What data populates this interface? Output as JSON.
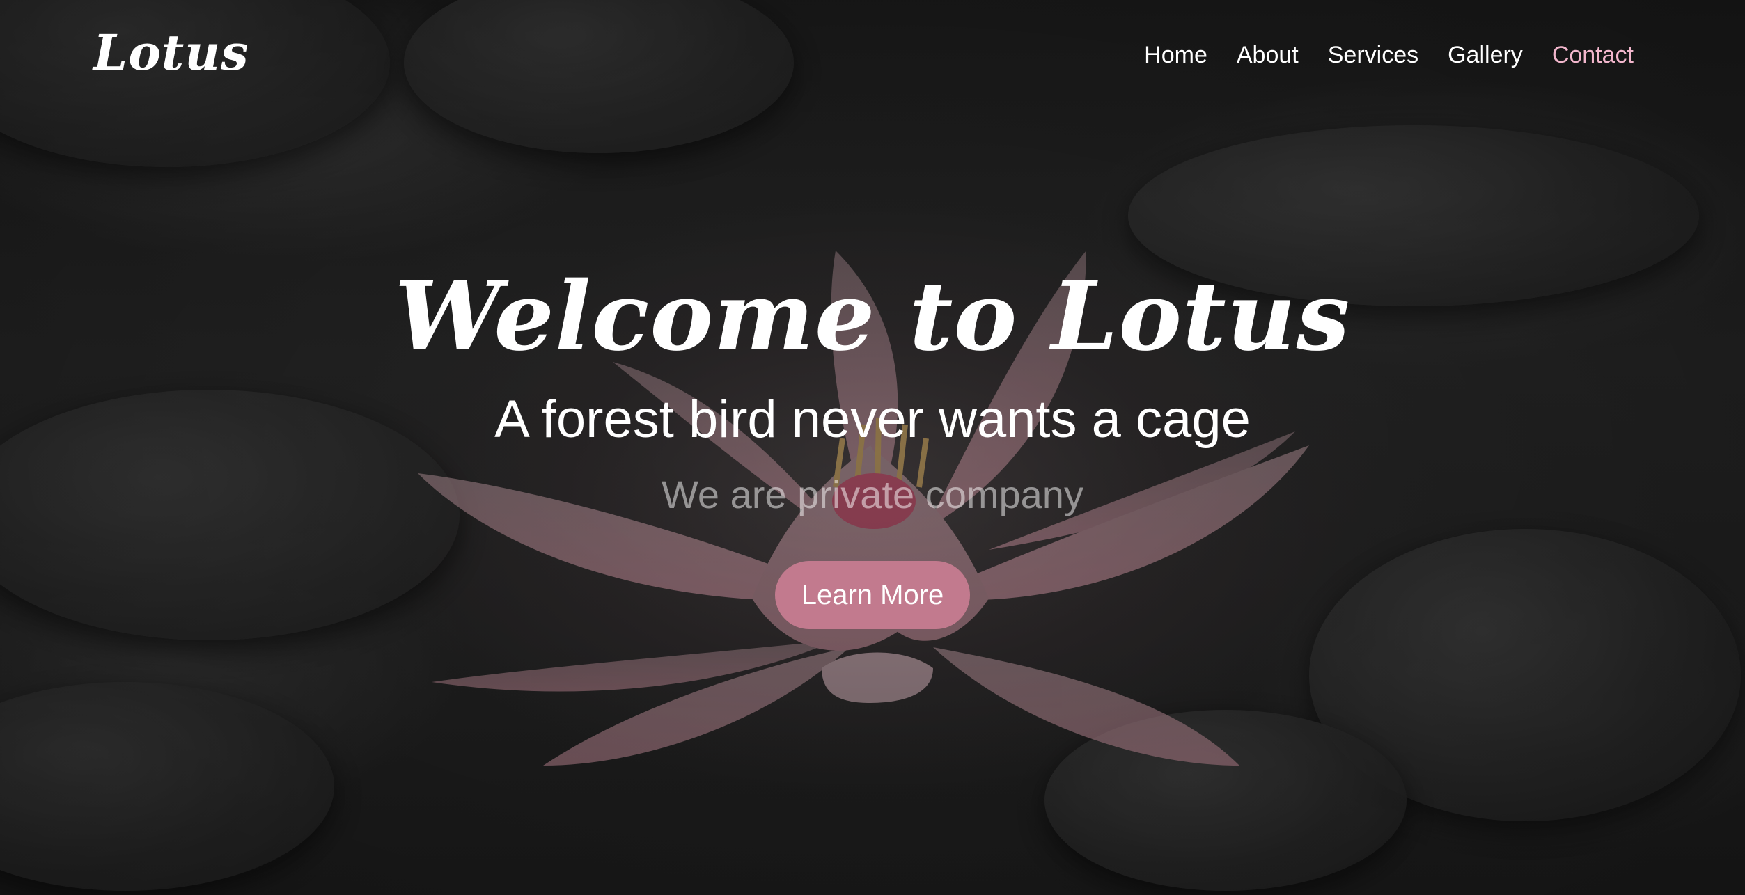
{
  "brand": {
    "logo": "Lotus"
  },
  "nav": {
    "items": [
      {
        "label": "Home"
      },
      {
        "label": "About"
      },
      {
        "label": "Services"
      },
      {
        "label": "Gallery"
      },
      {
        "label": "Contact"
      }
    ]
  },
  "hero": {
    "title": "Welcome to Lotus",
    "tagline": "A forest bird never wants a cage",
    "subline": "We are private company",
    "cta_label": "Learn More"
  },
  "colors": {
    "accent": "#f2b6cc",
    "button": "#c27a8e",
    "text": "#ffffff",
    "background": "#1c1c1c"
  }
}
